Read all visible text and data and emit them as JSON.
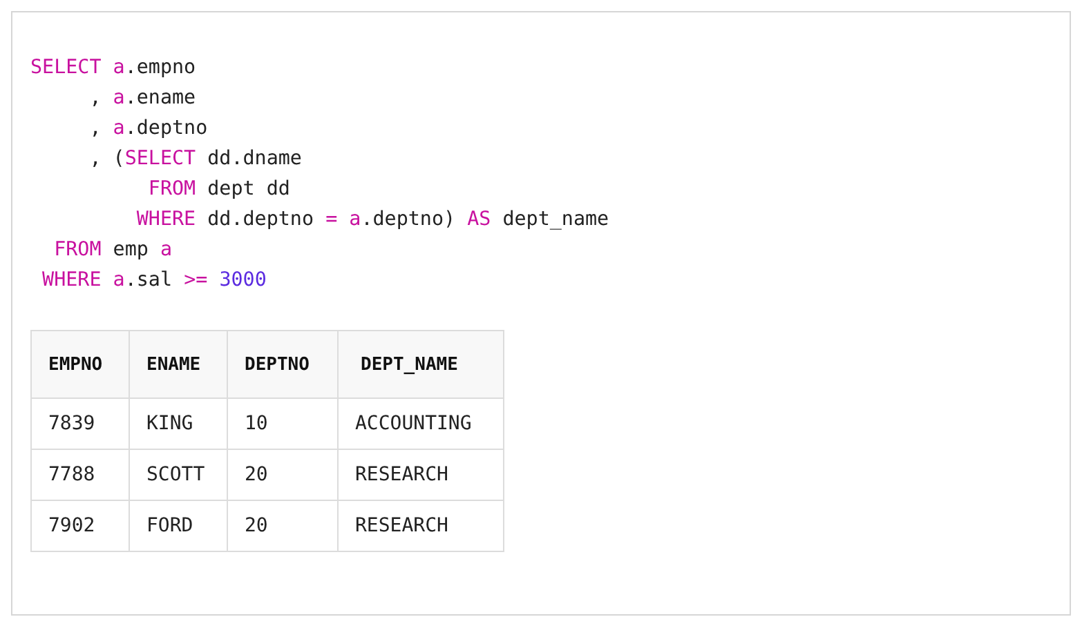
{
  "code": {
    "lines": [
      [
        {
          "kind": "keyword",
          "text": "SELECT"
        },
        {
          "kind": "keyword",
          "text": " a"
        },
        {
          "kind": "plain",
          "text": ".empno"
        }
      ],
      [
        {
          "kind": "plain",
          "text": "     , "
        },
        {
          "kind": "keyword",
          "text": "a"
        },
        {
          "kind": "plain",
          "text": ".ename"
        }
      ],
      [
        {
          "kind": "plain",
          "text": "     , "
        },
        {
          "kind": "keyword",
          "text": "a"
        },
        {
          "kind": "plain",
          "text": ".deptno"
        }
      ],
      [
        {
          "kind": "plain",
          "text": "     , ("
        },
        {
          "kind": "keyword",
          "text": "SELECT"
        },
        {
          "kind": "plain",
          "text": " dd.dname"
        }
      ],
      [
        {
          "kind": "keyword",
          "text": "          FROM"
        },
        {
          "kind": "plain",
          "text": " dept dd"
        }
      ],
      [
        {
          "kind": "keyword",
          "text": "         WHERE"
        },
        {
          "kind": "plain",
          "text": " dd.deptno "
        },
        {
          "kind": "keyword",
          "text": "="
        },
        {
          "kind": "keyword",
          "text": " a"
        },
        {
          "kind": "plain",
          "text": ".deptno) "
        },
        {
          "kind": "keyword",
          "text": "AS"
        },
        {
          "kind": "plain",
          "text": " dept_name"
        }
      ],
      [
        {
          "kind": "keyword",
          "text": "  FROM"
        },
        {
          "kind": "plain",
          "text": " emp "
        },
        {
          "kind": "keyword",
          "text": "a"
        }
      ],
      [
        {
          "kind": "keyword",
          "text": " WHERE"
        },
        {
          "kind": "keyword",
          "text": " a"
        },
        {
          "kind": "plain",
          "text": ".sal "
        },
        {
          "kind": "keyword",
          "text": ">="
        },
        {
          "kind": "number",
          "text": " 3000"
        }
      ]
    ]
  },
  "table": {
    "columns": [
      "EMPNO",
      "ENAME",
      "DEPTNO",
      "DEPT_NAME"
    ],
    "rows": [
      [
        "7839",
        "KING",
        "10",
        "ACCOUNTING"
      ],
      [
        "7788",
        "SCOTT",
        "20",
        "RESEARCH"
      ],
      [
        "7902",
        "FORD",
        "20",
        "RESEARCH"
      ]
    ]
  }
}
